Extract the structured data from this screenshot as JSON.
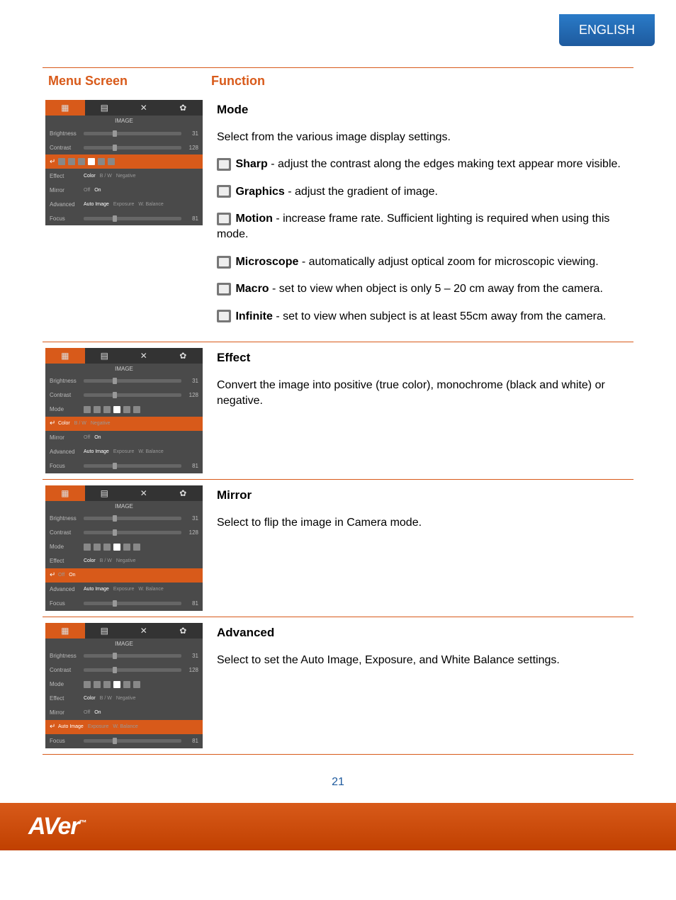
{
  "language": "ENGLISH",
  "header": {
    "menu": "Menu Screen",
    "func": "Function"
  },
  "menus": {
    "title": "IMAGE",
    "rows": {
      "brightness": "Brightness",
      "contrast": "Contrast",
      "mode": "Mode",
      "effect": "Effect",
      "mirror": "Mirror",
      "advanced": "Advanced",
      "focus": "Focus"
    },
    "vals": {
      "brightness": "31",
      "contrast": "128",
      "focus": "81"
    },
    "effectOpts": {
      "color": "Color",
      "bw": "B / W",
      "neg": "Negative"
    },
    "mirrorOpts": {
      "off": "Off",
      "on": "On"
    },
    "advOpts": {
      "auto": "Auto Image",
      "exp": "Exposure",
      "wb": "W. Balance"
    }
  },
  "sections": {
    "mode": {
      "title": "Mode",
      "intro": "Select from the various image display settings.",
      "sharp": {
        "name": "Sharp",
        "desc": " - adjust the contrast along the edges making text appear more visible."
      },
      "graphics": {
        "name": "Graphics",
        "desc": " - adjust the gradient of image."
      },
      "motion": {
        "name": "Motion",
        "desc": " - increase frame rate. Sufficient lighting is required when using this mode."
      },
      "microscope": {
        "name": "Microscope",
        "desc": " - automatically adjust optical zoom for microscopic viewing."
      },
      "macro": {
        "name": "Macro",
        "desc": " - set to view when object is only 5 – 20 cm away from the camera."
      },
      "infinite": {
        "name": "Infinite",
        "desc": " - set to view when subject is at least 55cm away from the camera."
      }
    },
    "effect": {
      "title": "Effect",
      "desc": "Convert the image into positive (true color), monochrome (black and white) or negative."
    },
    "mirror": {
      "title": "Mirror",
      "desc": "Select to flip the image in Camera mode."
    },
    "advanced": {
      "title": "Advanced",
      "desc": "Select to set the Auto Image, Exposure, and White Balance settings."
    }
  },
  "pageNumber": "21",
  "logo": "AVer"
}
